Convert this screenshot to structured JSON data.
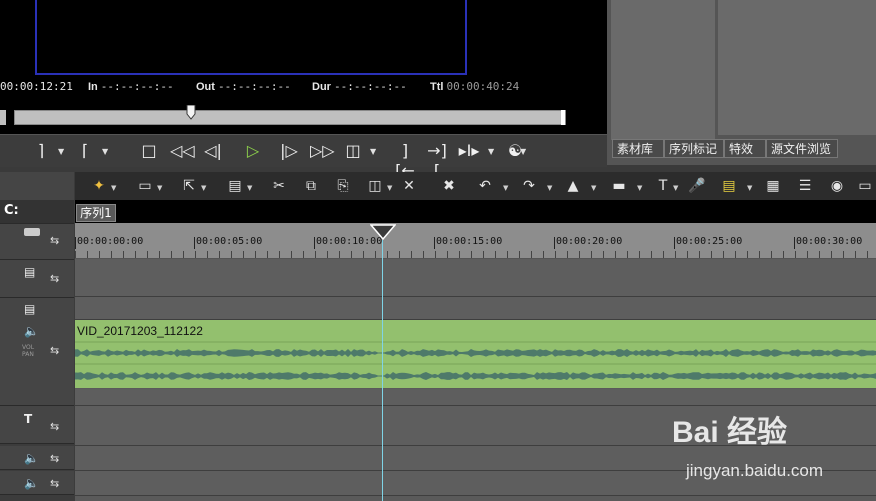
{
  "preview": {
    "timecode_current": "00:00:12:21",
    "in_label": "In",
    "in_value": "--:--:--:--",
    "out_label": "Out",
    "out_value": "--:--:--:--",
    "dur_label": "Dur",
    "dur_value": "--:--:--:--",
    "ttl_label": "Ttl",
    "ttl_value": "00:00:40:24",
    "scrub_position": 0.32
  },
  "bin_tabs": [
    "素材库",
    "序列标记",
    "特效",
    "源文件浏览"
  ],
  "sequence_tab": "序列1",
  "ruler_labels": [
    "00:00:00:00",
    "00:00:05:00",
    "00:00:10:00",
    "00:00:15:00",
    "00:00:20:00",
    "00:00:25:00",
    "00:00:30:00"
  ],
  "clip": {
    "name": "VID_20171203_112122",
    "color": "#93c06e"
  },
  "playhead_color": "#7fd4e6",
  "watermark": {
    "brand": "Bai 经验",
    "url": "jingyan.baidu.com"
  },
  "icons": {
    "transport": [
      "mark-in-icon",
      "mark-out-icon",
      "stop-icon",
      "rewind-icon",
      "step-back-icon",
      "play-icon",
      "step-forward-icon",
      "fast-forward-icon",
      "loop-icon",
      "goto-in-icon",
      "goto-out-icon",
      "insert-icon",
      "output-icon"
    ],
    "toolbar": [
      "razor-icon",
      "new-icon",
      "export-icon",
      "save-icon",
      "cut-icon",
      "copy-icon",
      "paste-icon",
      "link-icon",
      "split-icon",
      "trim-icon",
      "undo-icon",
      "redo-icon",
      "fade-icon",
      "film-icon",
      "title-icon",
      "microphone-icon",
      "render-icon",
      "grid-icon",
      "mixer-icon",
      "color-icon",
      "window-icon"
    ]
  }
}
